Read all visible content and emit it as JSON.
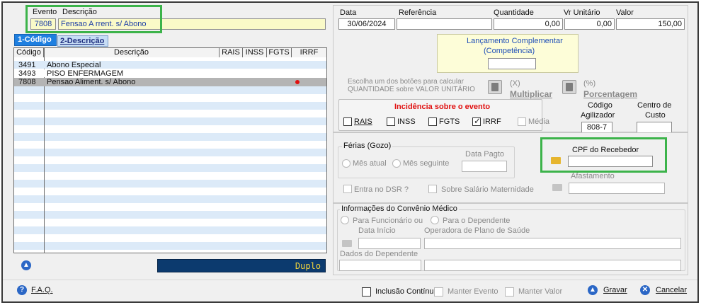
{
  "window": {
    "frame": "main-dialog"
  },
  "event_header": {
    "evento_label": "Evento",
    "descricao_label": "Descrição",
    "evento_value": "7808",
    "descricao_value": "Fensao A rrent. s/ Abono"
  },
  "tabs": [
    {
      "label": "1-Código",
      "active": true
    },
    {
      "label": "2-Descrição",
      "active": false
    }
  ],
  "grid": {
    "columns": [
      "Código",
      "Descrição",
      "RAIS",
      "INSS",
      "FGTS",
      "IRRF"
    ],
    "rows": [
      {
        "codigo": "3491",
        "descricao": "Abono Especial",
        "selected": false,
        "irrf_dot": false
      },
      {
        "codigo": "3493",
        "descricao": "PISO ENFERMAGEM",
        "selected": false,
        "irrf_dot": false
      },
      {
        "codigo": "7808",
        "descricao": "Pensao Aliment. s/ Abono",
        "selected": true,
        "irrf_dot": true
      }
    ],
    "duplo_label": "Duplo"
  },
  "entry": {
    "data_label": "Data",
    "referencia_label": "Referência",
    "quantidade_label": "Quantidade",
    "vr_unitario_label": "Vr Unitário",
    "valor_label": "Valor",
    "data_value": "30/06/2024",
    "referencia_value": "",
    "quantidade_value": "0,00",
    "vr_unitario_value": "0,00",
    "valor_value": "150,00"
  },
  "lancamento": {
    "title_line1": "Lançamento Complementar",
    "title_line2": "(Competência)",
    "value": ""
  },
  "calc": {
    "instruction_line1": "Escolha um dos botões para calcular",
    "instruction_line2": "QUANTIDADE sobre VALOR UNITÁRIO",
    "mult_symbol": "(X)",
    "mult_label": "Multiplicar",
    "perc_symbol": "(%)",
    "perc_label": "Porcentagem"
  },
  "incidencia": {
    "title": "Incidência sobre o evento",
    "items": [
      {
        "label": "RAIS",
        "checked": false,
        "disabled": false
      },
      {
        "label": "INSS",
        "checked": false,
        "disabled": false
      },
      {
        "label": "FGTS",
        "checked": false,
        "disabled": false
      },
      {
        "label": "IRRF",
        "checked": true,
        "disabled": false
      },
      {
        "label": "Média",
        "checked": false,
        "disabled": true
      }
    ]
  },
  "agilizador": {
    "label_line1": "Código",
    "label_line2": "Agilizador",
    "value": "808-7",
    "centro_line1": "Centro de",
    "centro_line2": "Custo",
    "centro_value": ""
  },
  "ferias": {
    "title": "Férias (Gozo)",
    "mes_atual": "Mês atual",
    "mes_seguinte": "Mês seguinte",
    "data_pagto_label": "Data Pagto",
    "data_pagto_value": "",
    "entra_dsr": "Entra no DSR ?",
    "sobre_salario": "Sobre Salário Maternidade"
  },
  "cpf": {
    "label": "CPF do Recebedor",
    "value": "",
    "afastamento_label": "Afastamento",
    "afastamento_value": ""
  },
  "convenio": {
    "title": "Informações do Convênio Médico",
    "para_funcionario": "Para Funcionário ou",
    "para_dependente": "Para o Dependente",
    "data_inicio_label": "Data Início",
    "operadora_label": "Operadora de Plano de Saúde",
    "dados_dependente_label": "Dados do Dependente"
  },
  "footer": {
    "faq": "F.A.Q.",
    "inclusao": "Inclusão Contínua",
    "manter_evento": "Manter Evento",
    "manter_valor": "Manter Valor",
    "gravar": "Gravar",
    "cancelar": "Cancelar"
  },
  "colors": {
    "highlight_green": "#3cb34a",
    "tab_active": "#1e7fe0",
    "grid_stripe": "#dceaf8",
    "selected_row": "#b4b4b4",
    "duplo_bg": "#0c3a6e",
    "duplo_text": "#f2d43c",
    "incidencia_red": "#e01010",
    "icon_blue": "#2b67c6"
  },
  "icons": [
    "up-arrow-icon",
    "help-icon",
    "folder-icon",
    "calculator-icon",
    "gravar-icon",
    "cancelar-icon"
  ]
}
